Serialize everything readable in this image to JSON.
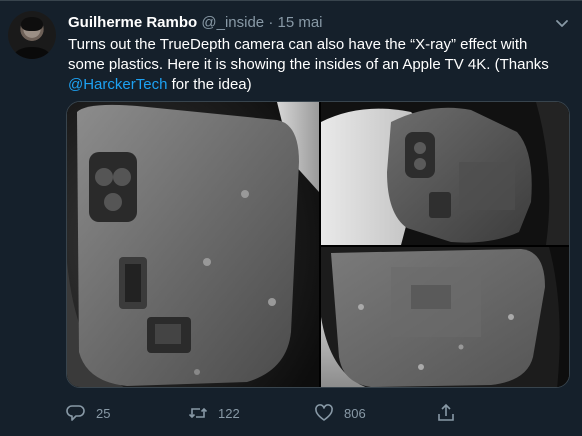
{
  "tweet": {
    "author_name": "Guilherme Rambo",
    "handle": "@_inside",
    "separator": "·",
    "date": "15 mai",
    "text_before_mention": "Turns out the TrueDepth camera can also have the “X-ray” effect with some plastics. Here it is showing the insides of an Apple TV 4K. (Thanks ",
    "mention": "@HarckerTech",
    "text_after_mention": " for the idea)"
  },
  "actions": {
    "replies": "25",
    "retweets": "122",
    "likes": "806"
  },
  "icons": {
    "caret": "chevron-down-icon",
    "reply": "reply-icon",
    "retweet": "retweet-icon",
    "like": "heart-icon",
    "share": "share-icon"
  },
  "colors": {
    "background": "#15202b",
    "accent": "#1da1f2",
    "muted": "#8899a6"
  }
}
